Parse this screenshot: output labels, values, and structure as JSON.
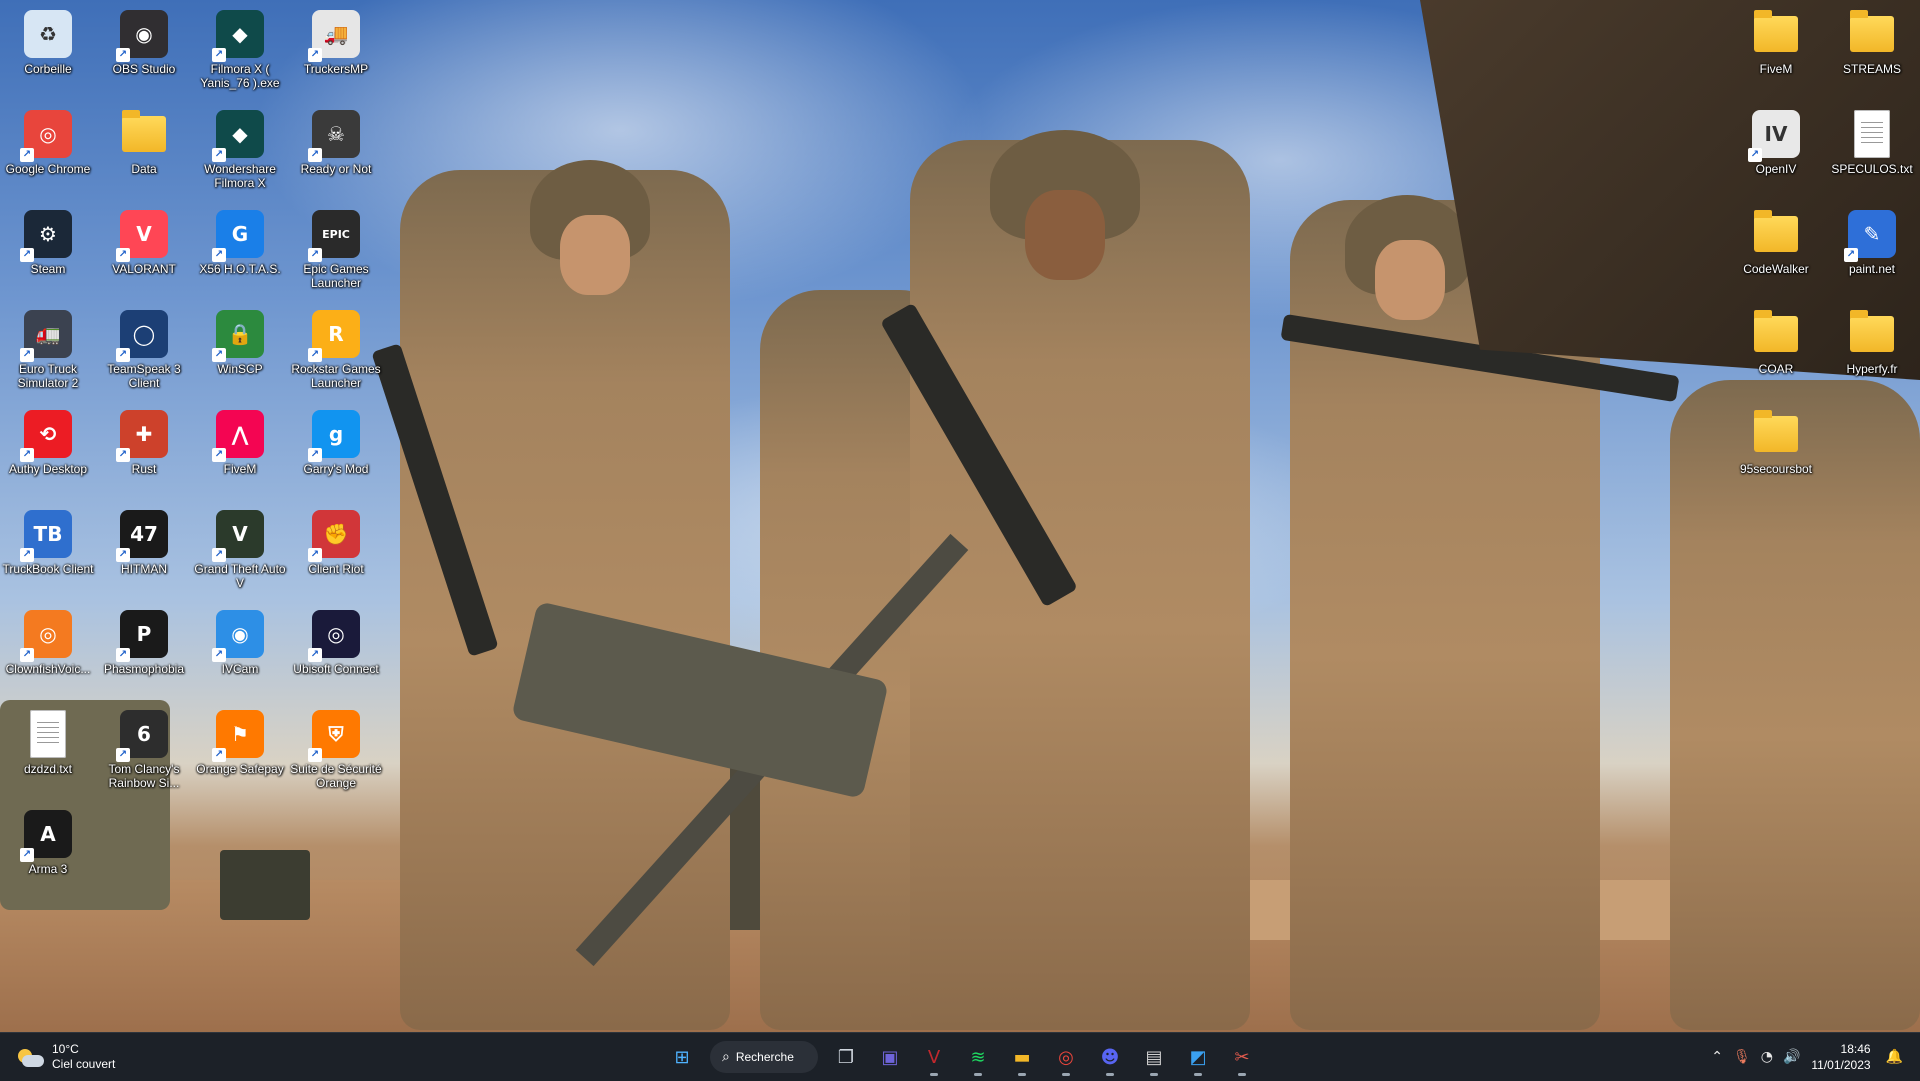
{
  "desktop": {
    "left_icons": [
      {
        "label": "Corbeille",
        "icon": "recycle-bin-icon",
        "color": "#d7e6f4",
        "glyph": "♻"
      },
      {
        "label": "OBS Studio",
        "icon": "obs-icon",
        "color": "#302e31",
        "glyph": "◉"
      },
      {
        "label": "Filmora X ( Yanis_76 ).exe",
        "icon": "filmora-icon",
        "color": "#0f4a4a",
        "glyph": "◆"
      },
      {
        "label": "TruckersMP",
        "icon": "truckersmp-icon",
        "color": "#e6e6e6",
        "glyph": "🚚"
      },
      {
        "label": "Google Chrome",
        "icon": "chrome-icon",
        "color": "#e8453c",
        "glyph": "◎"
      },
      {
        "label": "Data",
        "icon": "folder-icon",
        "color": "#f2b728",
        "glyph": ""
      },
      {
        "label": "Wondershare Filmora X",
        "icon": "filmora-icon",
        "color": "#0f4a4a",
        "glyph": "◆"
      },
      {
        "label": "Ready or Not",
        "icon": "ready-or-not-icon",
        "color": "#3a3a3a",
        "glyph": "☠"
      },
      {
        "label": "Steam",
        "icon": "steam-icon",
        "color": "#1b2838",
        "glyph": "⚙"
      },
      {
        "label": "VALORANT",
        "icon": "valorant-icon",
        "color": "#ff4655",
        "glyph": "V"
      },
      {
        "label": "X56 H.O.T.A.S.",
        "icon": "logitech-icon",
        "color": "#1a7fe8",
        "glyph": "G"
      },
      {
        "label": "Epic Games Launcher",
        "icon": "epic-games-icon",
        "color": "#2a2a2a",
        "glyph": "EPIC"
      },
      {
        "label": "Euro Truck Simulator 2",
        "icon": "ets2-icon",
        "color": "#3b4250",
        "glyph": "🚛"
      },
      {
        "label": "TeamSpeak 3 Client",
        "icon": "teamspeak-icon",
        "color": "#1c3f75",
        "glyph": "◯"
      },
      {
        "label": "WinSCP",
        "icon": "winscp-icon",
        "color": "#2c8a3e",
        "glyph": "🔒"
      },
      {
        "label": "Rockstar Games Launcher",
        "icon": "rockstar-icon",
        "color": "#fcaf17",
        "glyph": "R"
      },
      {
        "label": "Authy Desktop",
        "icon": "authy-icon",
        "color": "#ec1c24",
        "glyph": "⟲"
      },
      {
        "label": "Rust",
        "icon": "rust-icon",
        "color": "#cd412b",
        "glyph": "✚"
      },
      {
        "label": "FiveM",
        "icon": "fivem-icon",
        "color": "#f40552",
        "glyph": "⋀"
      },
      {
        "label": "Garry's Mod",
        "icon": "gmod-icon",
        "color": "#1194f0",
        "glyph": "g"
      },
      {
        "label": "TruckBook Client",
        "icon": "truckbook-icon",
        "color": "#2f6fce",
        "glyph": "TB"
      },
      {
        "label": "HITMAN",
        "icon": "hitman-icon",
        "color": "#1a1a1a",
        "glyph": "47"
      },
      {
        "label": "Grand Theft Auto V",
        "icon": "gta5-icon",
        "color": "#2b3a2b",
        "glyph": "V"
      },
      {
        "label": "Client Riot",
        "icon": "riot-icon",
        "color": "#d13639",
        "glyph": "✊"
      },
      {
        "label": "ClownfishVoic...",
        "icon": "clownfish-icon",
        "color": "#f47a20",
        "glyph": "◎"
      },
      {
        "label": "Phasmophobia",
        "icon": "phasmophobia-icon",
        "color": "#1a1a1a",
        "glyph": "P"
      },
      {
        "label": "IVCam",
        "icon": "ivcam-icon",
        "color": "#2d8fe6",
        "glyph": "◉"
      },
      {
        "label": "Ubisoft Connect",
        "icon": "ubisoft-icon",
        "color": "#1a1a3a",
        "glyph": "◎"
      },
      {
        "label": "dzdzd.txt",
        "icon": "text-file-icon",
        "color": "#ffffff",
        "glyph": ""
      },
      {
        "label": "Tom Clancy's Rainbow Si...",
        "icon": "rainbow-six-icon",
        "color": "#2d2d2d",
        "glyph": "6"
      },
      {
        "label": "Orange Safepay",
        "icon": "orange-safepay-icon",
        "color": "#ff7900",
        "glyph": "⚑"
      },
      {
        "label": "Suite de Sécurité Orange",
        "icon": "orange-security-icon",
        "color": "#ff7900",
        "glyph": "⛨"
      },
      {
        "label": "Arma 3",
        "icon": "arma3-icon",
        "color": "#1a1a1a",
        "glyph": "A"
      }
    ],
    "right_icons": [
      {
        "label": "FiveM",
        "icon": "folder-icon",
        "color": "#f2b728",
        "glyph": ""
      },
      {
        "label": "STREAMS",
        "icon": "folder-icon",
        "color": "#f2b728",
        "glyph": ""
      },
      {
        "label": "OpenIV",
        "icon": "openiv-icon",
        "color": "#e8e8e8",
        "glyph": "IV"
      },
      {
        "label": "SPECULOS.txt",
        "icon": "text-file-icon",
        "color": "#ffffff",
        "glyph": ""
      },
      {
        "label": "CodeWalker",
        "icon": "folder-icon",
        "color": "#f2b728",
        "glyph": ""
      },
      {
        "label": "paint.net",
        "icon": "paintnet-icon",
        "color": "#2e6fd8",
        "glyph": "✎"
      },
      {
        "label": "COAR",
        "icon": "folder-icon",
        "color": "#f2b728",
        "glyph": ""
      },
      {
        "label": "Hyperfy.fr",
        "icon": "folder-icon",
        "color": "#f2b728",
        "glyph": ""
      },
      {
        "label": "95secoursbot",
        "icon": "folder-icon",
        "color": "#f2b728",
        "glyph": ""
      }
    ]
  },
  "taskbar": {
    "weather": {
      "temp": "10°C",
      "condition": "Ciel couvert"
    },
    "search_label": "Recherche",
    "apps": [
      {
        "name": "start-button",
        "glyph": "⊞",
        "color": "#4fb3ff"
      },
      {
        "name": "task-view-icon",
        "glyph": "❐",
        "color": "#cfd6de"
      },
      {
        "name": "teams-chat-icon",
        "glyph": "▣",
        "color": "#6e64d9"
      },
      {
        "name": "voicemeeter-icon",
        "glyph": "V",
        "color": "#c0282d"
      },
      {
        "name": "spotify-icon",
        "glyph": "≋",
        "color": "#1ed760"
      },
      {
        "name": "file-explorer-icon",
        "glyph": "▬",
        "color": "#f2b728"
      },
      {
        "name": "chrome-icon",
        "glyph": "◎",
        "color": "#e8453c"
      },
      {
        "name": "discord-icon",
        "glyph": "☻",
        "color": "#5865f2"
      },
      {
        "name": "gamepad-icon",
        "glyph": "▤",
        "color": "#d0d0d0"
      },
      {
        "name": "photos-icon",
        "glyph": "◩",
        "color": "#3aa0f0"
      },
      {
        "name": "snipping-tool-icon",
        "glyph": "✂",
        "color": "#e05a4d"
      }
    ],
    "clock": {
      "time": "18:46",
      "date": "11/01/2023"
    }
  }
}
